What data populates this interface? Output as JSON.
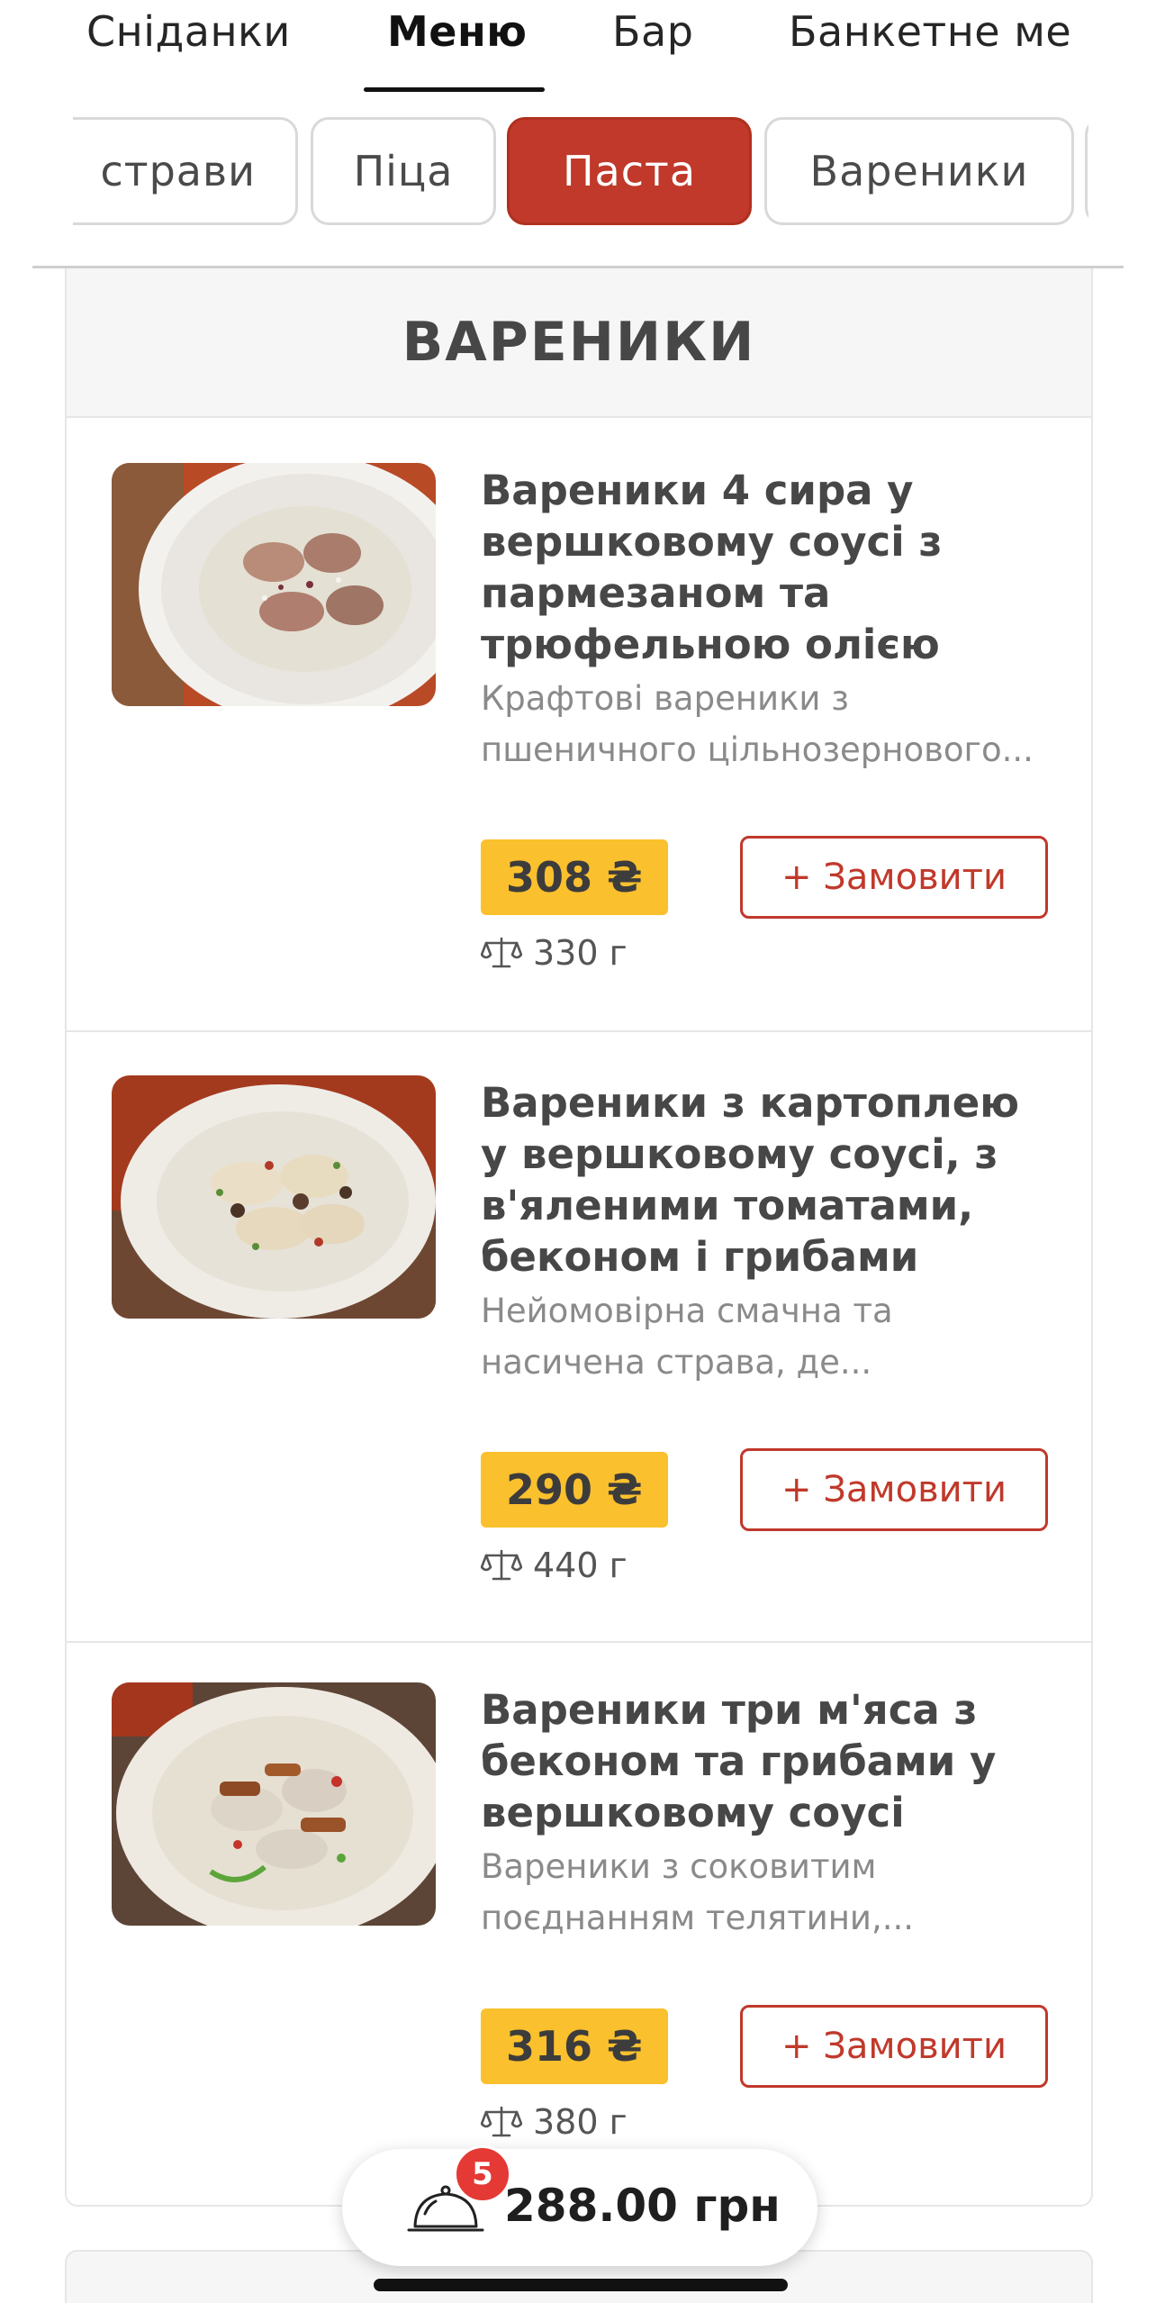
{
  "top_tabs": [
    {
      "label": "Сніданки"
    },
    {
      "label": "Меню"
    },
    {
      "label": "Бар"
    },
    {
      "label": "Банкетне ме"
    }
  ],
  "categories": [
    {
      "label": "страви"
    },
    {
      "label": "Піца"
    },
    {
      "label": "Паста"
    },
    {
      "label": "Вареники"
    }
  ],
  "section": {
    "title": "ВАРЕНИКИ"
  },
  "items": [
    {
      "title_lines": [
        "Вареники 4 сира у",
        "вершковому соусі з",
        "пармезаном та",
        "трюфельною олією"
      ],
      "desc_lines": [
        "Крафтові вареники з",
        "пшеничного цільнозернового..."
      ],
      "price": "308 ₴",
      "order_label": "+ Замовити",
      "weight": "330 г"
    },
    {
      "title_lines": [
        "Вареники з картоплею",
        "у вершковому соусі, з",
        "в'яленими томатами,",
        "беконом і грибами"
      ],
      "desc_lines": [
        "Нейомовірна смачна та",
        "насичена страва, де..."
      ],
      "price": "290 ₴",
      "order_label": "+ Замовити",
      "weight": "440 г"
    },
    {
      "title_lines": [
        "Вареники три м'яса з",
        "беконом та грибами у",
        "вершковому соусі"
      ],
      "desc_lines": [
        "Вареники з соковитим",
        "поєднанням телятини,..."
      ],
      "price": "316 ₴",
      "order_label": "+ Замовити",
      "weight": "380 г"
    }
  ],
  "cart": {
    "count": "5",
    "total": "288.00 грн"
  },
  "colors": {
    "accent": "#c0392b",
    "price_bg": "#fbc02d",
    "badge": "#e53935"
  }
}
